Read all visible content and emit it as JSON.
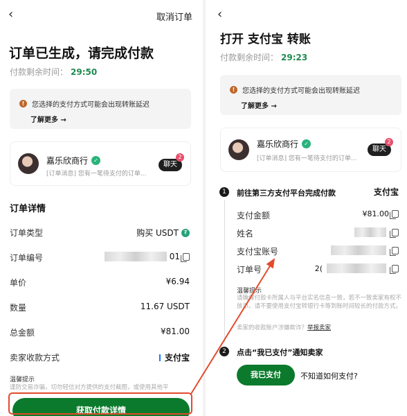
{
  "left": {
    "back_glyph": "‹",
    "cancel_label": "取消订单",
    "title": "订单已生成，请完成付款",
    "timer_label": "付款剩余时间：",
    "timer_value": "29:50",
    "notice_text": "您选择的支付方式可能会出现转账延迟",
    "notice_more": "了解更多 →",
    "merchant_name": "嘉乐欣商行",
    "merchant_msg": "[订单消息] 您有一笔待支付的订单...",
    "chat_label": "聊天",
    "chat_badge": "2",
    "details_title": "订单详情",
    "rows": [
      {
        "label": "订单类型",
        "value": "购买 USDT"
      },
      {
        "label": "订单编号",
        "value": "01"
      },
      {
        "label": "单价",
        "value": "¥6.94"
      },
      {
        "label": "数量",
        "value": "11.67 USDT"
      },
      {
        "label": "总金额",
        "value": "¥81.00"
      },
      {
        "label": "卖家收款方式",
        "value": "支付宝"
      }
    ],
    "tip_title": "温馨提示",
    "tip_text": "谨防交易诈骗，切勿轻信对方提供的支付截图，或使用其他平",
    "cta_label": "获取付款详情"
  },
  "right": {
    "back_glyph": "‹",
    "title": "打开 支付宝 转账",
    "timer_label": "付款剩余时间：",
    "timer_value": "29:23",
    "notice_text": "您选择的支付方式可能会出现转账延迟",
    "notice_more": "了解更多 →",
    "merchant_name": "嘉乐欣商行",
    "merchant_msg": "[订单消息] 您有一笔待支付的订单...",
    "chat_label": "聊天",
    "chat_badge": "2",
    "step1_num": "1",
    "step1_title": "前往第三方支付平台完成付款",
    "step1_method": "支付宝",
    "rows": [
      {
        "label": "支付金额",
        "value": "¥81.00"
      },
      {
        "label": "姓名",
        "value": ""
      },
      {
        "label": "支付宝账号",
        "value": ""
      },
      {
        "label": "订单号",
        "value": "2("
      }
    ],
    "tip_title": "温馨提示",
    "tip_text": "请确保付款卡所属人与平台实名信息一致，若不一致卖家有权不放币。请不要使用支付宝转银行卡等到账时间较长的付款方式。",
    "report_text": "卖家的收款账户涉嫌欺诈？",
    "report_link": "举报卖家",
    "step2_num": "2",
    "step2_title": "点击“我已支付”通知卖家",
    "paid_label": "我已支付",
    "unknown_label": "不知道如何支付?"
  },
  "colors": {
    "accent_green": "#0b7a2c",
    "timer_green": "#1e8a4f",
    "highlight_red": "#e24a2c",
    "badge_pink": "#e6506d"
  }
}
